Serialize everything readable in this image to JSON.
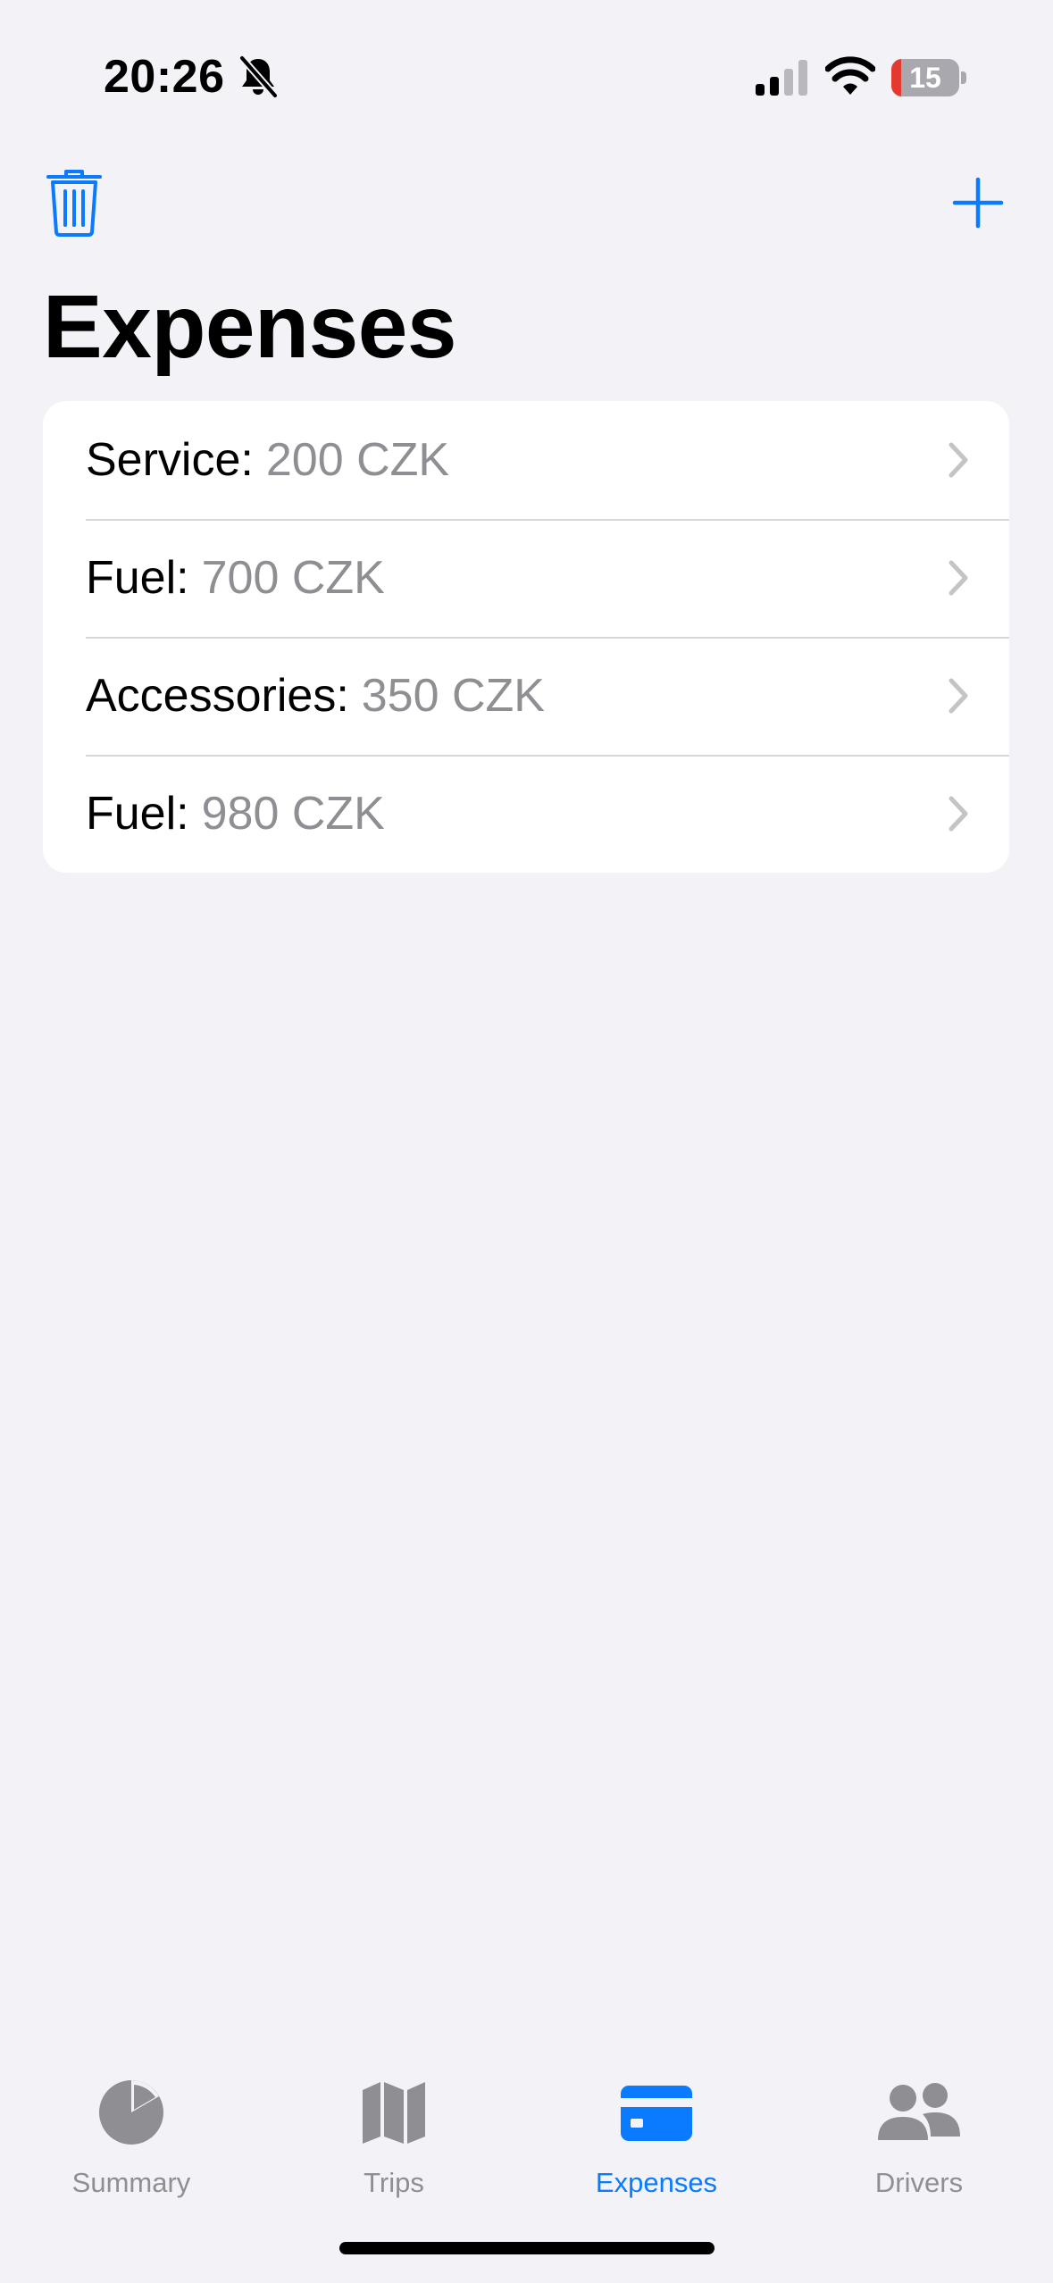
{
  "status_bar": {
    "time": "20:26",
    "battery": "15",
    "battery_level": 0.15,
    "icons": [
      "bell-slash-icon",
      "cellular-signal-icon",
      "wifi-icon",
      "battery-icon"
    ]
  },
  "nav": {
    "left_icon": "trash-icon",
    "right_icon": "plus-icon",
    "title": "Expenses"
  },
  "expenses": [
    {
      "category": "Service",
      "separator": ":",
      "amount": "200 CZK"
    },
    {
      "category": "Fuel",
      "separator": ":",
      "amount": "700 CZK"
    },
    {
      "category": "Accessories",
      "separator": ":",
      "amount": "350 CZK"
    },
    {
      "category": "Fuel",
      "separator": ":",
      "amount": "980 CZK"
    }
  ],
  "tabbar": {
    "tabs": [
      {
        "label": "Summary",
        "icon": "pie-chart-icon"
      },
      {
        "label": "Trips",
        "icon": "map-icon"
      },
      {
        "label": "Expenses",
        "icon": "credit-card-icon",
        "active": true
      },
      {
        "label": "Drivers",
        "icon": "people-icon"
      }
    ]
  },
  "colors": {
    "accent": "#0A7AFF",
    "background": "#F2F2F7",
    "secondary_text": "#8E8E93",
    "battery_low": "#E5392F"
  }
}
